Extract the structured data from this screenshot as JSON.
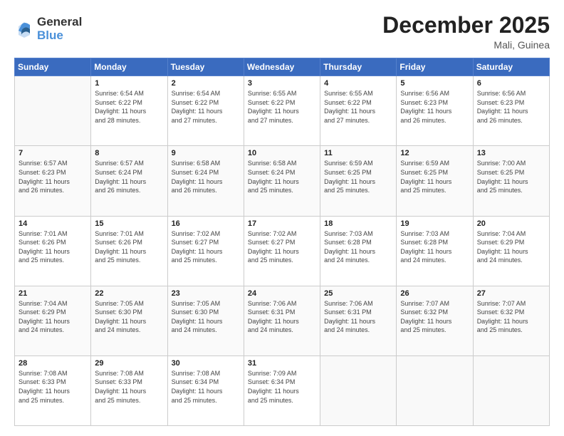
{
  "logo": {
    "general": "General",
    "blue": "Blue"
  },
  "header": {
    "month": "December 2025",
    "location": "Mali, Guinea"
  },
  "days_of_week": [
    "Sunday",
    "Monday",
    "Tuesday",
    "Wednesday",
    "Thursday",
    "Friday",
    "Saturday"
  ],
  "weeks": [
    [
      {
        "day": "",
        "info": ""
      },
      {
        "day": "1",
        "info": "Sunrise: 6:54 AM\nSunset: 6:22 PM\nDaylight: 11 hours\nand 28 minutes."
      },
      {
        "day": "2",
        "info": "Sunrise: 6:54 AM\nSunset: 6:22 PM\nDaylight: 11 hours\nand 27 minutes."
      },
      {
        "day": "3",
        "info": "Sunrise: 6:55 AM\nSunset: 6:22 PM\nDaylight: 11 hours\nand 27 minutes."
      },
      {
        "day": "4",
        "info": "Sunrise: 6:55 AM\nSunset: 6:22 PM\nDaylight: 11 hours\nand 27 minutes."
      },
      {
        "day": "5",
        "info": "Sunrise: 6:56 AM\nSunset: 6:23 PM\nDaylight: 11 hours\nand 26 minutes."
      },
      {
        "day": "6",
        "info": "Sunrise: 6:56 AM\nSunset: 6:23 PM\nDaylight: 11 hours\nand 26 minutes."
      }
    ],
    [
      {
        "day": "7",
        "info": "Sunrise: 6:57 AM\nSunset: 6:23 PM\nDaylight: 11 hours\nand 26 minutes."
      },
      {
        "day": "8",
        "info": "Sunrise: 6:57 AM\nSunset: 6:24 PM\nDaylight: 11 hours\nand 26 minutes."
      },
      {
        "day": "9",
        "info": "Sunrise: 6:58 AM\nSunset: 6:24 PM\nDaylight: 11 hours\nand 26 minutes."
      },
      {
        "day": "10",
        "info": "Sunrise: 6:58 AM\nSunset: 6:24 PM\nDaylight: 11 hours\nand 25 minutes."
      },
      {
        "day": "11",
        "info": "Sunrise: 6:59 AM\nSunset: 6:25 PM\nDaylight: 11 hours\nand 25 minutes."
      },
      {
        "day": "12",
        "info": "Sunrise: 6:59 AM\nSunset: 6:25 PM\nDaylight: 11 hours\nand 25 minutes."
      },
      {
        "day": "13",
        "info": "Sunrise: 7:00 AM\nSunset: 6:25 PM\nDaylight: 11 hours\nand 25 minutes."
      }
    ],
    [
      {
        "day": "14",
        "info": "Sunrise: 7:01 AM\nSunset: 6:26 PM\nDaylight: 11 hours\nand 25 minutes."
      },
      {
        "day": "15",
        "info": "Sunrise: 7:01 AM\nSunset: 6:26 PM\nDaylight: 11 hours\nand 25 minutes."
      },
      {
        "day": "16",
        "info": "Sunrise: 7:02 AM\nSunset: 6:27 PM\nDaylight: 11 hours\nand 25 minutes."
      },
      {
        "day": "17",
        "info": "Sunrise: 7:02 AM\nSunset: 6:27 PM\nDaylight: 11 hours\nand 25 minutes."
      },
      {
        "day": "18",
        "info": "Sunrise: 7:03 AM\nSunset: 6:28 PM\nDaylight: 11 hours\nand 24 minutes."
      },
      {
        "day": "19",
        "info": "Sunrise: 7:03 AM\nSunset: 6:28 PM\nDaylight: 11 hours\nand 24 minutes."
      },
      {
        "day": "20",
        "info": "Sunrise: 7:04 AM\nSunset: 6:29 PM\nDaylight: 11 hours\nand 24 minutes."
      }
    ],
    [
      {
        "day": "21",
        "info": "Sunrise: 7:04 AM\nSunset: 6:29 PM\nDaylight: 11 hours\nand 24 minutes."
      },
      {
        "day": "22",
        "info": "Sunrise: 7:05 AM\nSunset: 6:30 PM\nDaylight: 11 hours\nand 24 minutes."
      },
      {
        "day": "23",
        "info": "Sunrise: 7:05 AM\nSunset: 6:30 PM\nDaylight: 11 hours\nand 24 minutes."
      },
      {
        "day": "24",
        "info": "Sunrise: 7:06 AM\nSunset: 6:31 PM\nDaylight: 11 hours\nand 24 minutes."
      },
      {
        "day": "25",
        "info": "Sunrise: 7:06 AM\nSunset: 6:31 PM\nDaylight: 11 hours\nand 24 minutes."
      },
      {
        "day": "26",
        "info": "Sunrise: 7:07 AM\nSunset: 6:32 PM\nDaylight: 11 hours\nand 25 minutes."
      },
      {
        "day": "27",
        "info": "Sunrise: 7:07 AM\nSunset: 6:32 PM\nDaylight: 11 hours\nand 25 minutes."
      }
    ],
    [
      {
        "day": "28",
        "info": "Sunrise: 7:08 AM\nSunset: 6:33 PM\nDaylight: 11 hours\nand 25 minutes."
      },
      {
        "day": "29",
        "info": "Sunrise: 7:08 AM\nSunset: 6:33 PM\nDaylight: 11 hours\nand 25 minutes."
      },
      {
        "day": "30",
        "info": "Sunrise: 7:08 AM\nSunset: 6:34 PM\nDaylight: 11 hours\nand 25 minutes."
      },
      {
        "day": "31",
        "info": "Sunrise: 7:09 AM\nSunset: 6:34 PM\nDaylight: 11 hours\nand 25 minutes."
      },
      {
        "day": "",
        "info": ""
      },
      {
        "day": "",
        "info": ""
      },
      {
        "day": "",
        "info": ""
      }
    ]
  ]
}
